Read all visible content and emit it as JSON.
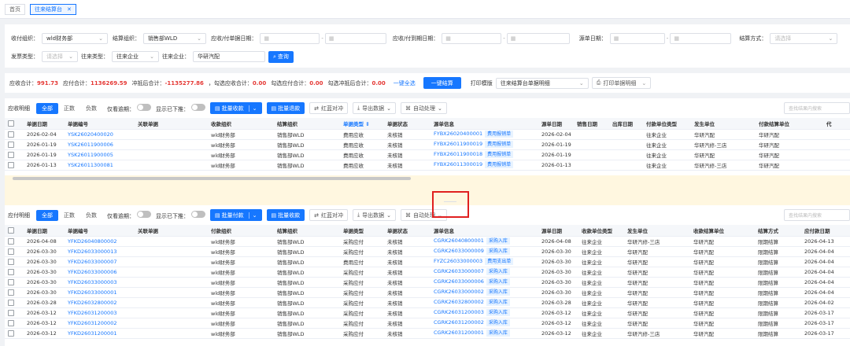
{
  "tabs": [
    {
      "label": "首页"
    },
    {
      "label": "往来结算台"
    }
  ],
  "filters": {
    "row1": {
      "pay_org_label": "收付组织：",
      "pay_org_value": "wld财务部",
      "settle_org_label": "结算组织：",
      "settle_org_value": "销售部WLD",
      "ar_date_label": "应收/付单据日期：",
      "due_date_label": "应收/付到期日期：",
      "src_date_label": "源单日期：",
      "settle_method_label": "结算方式：",
      "settle_method_placeholder": "请选择"
    },
    "row2": {
      "invoice_type_label": "发票类型：",
      "invoice_type_placeholder": "请选择",
      "party_type_label": "往来类型：",
      "party_type_value": "往来企业",
      "party_label": "往来企业：",
      "party_value": "华研汽配",
      "query_label": "查询"
    }
  },
  "summary": {
    "ar_total_label": "应收合计：",
    "ar_total": "991.73",
    "ap_total_label": "应付合计：",
    "ap_total": "1136269.59",
    "offset_label": "冲抵后合计：",
    "offset_total": "-1135277.86",
    "sel_ar_label": "，勾选应收合计：",
    "sel_ar": "0.00",
    "sel_ap_label": "勾选应付合计：",
    "sel_ap": "0.00",
    "sel_offset_label": "勾选冲抵后合计：",
    "sel_offset": "0.00",
    "select_all": "一键全选",
    "one_click_settle": "一键结算",
    "print_template_label": "打印模版",
    "print_template_value": "往来结算台单据明细",
    "print_label": "打印单据明细"
  },
  "ar": {
    "title": "应收明细",
    "seg": [
      "全部",
      "正数",
      "负数"
    ],
    "overdue": "仅看逾期：",
    "show_settled": "显示已下推：",
    "batch_receive": "批量收款",
    "batch_refund": "批量退款",
    "red_offset": "红蓝对冲",
    "export": "导出数据",
    "auto_process": "自动处理",
    "search_placeholder": "查找结果内搜索",
    "columns": [
      "单据日期",
      "单据编号",
      "关联单据",
      "收款组织",
      "结算组织",
      "单据类型",
      "单据状态",
      "源单信息",
      "源单日期",
      "销售日期",
      "出库日期",
      "付款单位类型",
      "发生单位",
      "付款结算单位",
      "代"
    ],
    "rows": [
      {
        "date": "2026-02-04",
        "no": "YSK26020400020",
        "rel": "",
        "org": "wld财务部",
        "sorg": "销售部WLD",
        "type": "费用应收",
        "status": "未核销",
        "src": "FYBX26020400001",
        "tag": "费用报销单",
        "srcdate": "2026-02-04",
        "saledate": "",
        "outdate": "",
        "ptype": "往来企业",
        "unit": "华研汽配",
        "sunit": "华研汽配"
      },
      {
        "date": "2026-01-19",
        "no": "YSK26011900006",
        "rel": "",
        "org": "wld财务部",
        "sorg": "销售部WLD",
        "type": "费用应收",
        "status": "未核销",
        "src": "FYBX26011900019",
        "tag": "费用报销单",
        "srcdate": "2026-01-19",
        "saledate": "",
        "outdate": "",
        "ptype": "往来企业",
        "unit": "华研汽修-三店",
        "sunit": "华研汽配"
      },
      {
        "date": "2026-01-19",
        "no": "YSK26011900005",
        "rel": "",
        "org": "wld财务部",
        "sorg": "销售部WLD",
        "type": "费用应收",
        "status": "未核销",
        "src": "FYBX26011900018",
        "tag": "费用报销单",
        "srcdate": "2026-01-19",
        "saledate": "",
        "outdate": "",
        "ptype": "往来企业",
        "unit": "华研汽配",
        "sunit": "华研汽配"
      },
      {
        "date": "2026-01-13",
        "no": "YSK26011300081",
        "rel": "",
        "org": "wld财务部",
        "sorg": "销售部WLD",
        "type": "费用应收",
        "status": "未核销",
        "src": "FYBX26011300019",
        "tag": "费用报销单",
        "srcdate": "2026-01-13",
        "saledate": "",
        "outdate": "",
        "ptype": "往来企业",
        "unit": "华研汽修-三店",
        "sunit": "华研汽配"
      }
    ]
  },
  "ap": {
    "title": "应付明细",
    "seg": [
      "全部",
      "正数",
      "负数"
    ],
    "overdue": "仅看逾期：",
    "show_settled": "显示已下推：",
    "batch_pay": "批量付款",
    "batch_receive": "批量收款",
    "red_offset": "红蓝对冲",
    "export": "导出数据",
    "auto_process": "自动处理",
    "search_placeholder": "查找结果内搜索",
    "columns": [
      "单据日期",
      "单据编号",
      "关联单据",
      "付款组织",
      "结算组织",
      "单据类型",
      "单据状态",
      "源单信息",
      "源单日期",
      "收款单位类型",
      "发生单位",
      "收款结算单位",
      "结算方式",
      "应付款日期"
    ],
    "rows": [
      {
        "date": "2026-04-08",
        "no": "YFKD26040800002",
        "org": "wld财务部",
        "sorg": "销售部WLD",
        "type": "采购应付",
        "status": "未核销",
        "src": "CGRK26040800001",
        "tag": "采购入库",
        "srcdate": "2026-04-08",
        "utype": "往来企业",
        "unit": "华研汽修-三店",
        "sunit": "华研汽配",
        "method": "限期结算",
        "due": "2026-04-13"
      },
      {
        "date": "2026-03-30",
        "no": "YFKD26033000013",
        "org": "wld财务部",
        "sorg": "销售部WLD",
        "type": "采购应付",
        "status": "未核销",
        "src": "CGRK26033000009",
        "tag": "采购入库",
        "srcdate": "2026-03-30",
        "utype": "往来企业",
        "unit": "华研汽配",
        "sunit": "华研汽配",
        "method": "限期结算",
        "due": "2026-04-04"
      },
      {
        "date": "2026-03-30",
        "no": "YFKD26033000007",
        "org": "wld财务部",
        "sorg": "销售部WLD",
        "type": "费用应付",
        "status": "未核销",
        "src": "FYZC26033000003",
        "tag": "费用支出单",
        "srcdate": "2026-03-30",
        "utype": "往来企业",
        "unit": "华研汽配",
        "sunit": "华研汽配",
        "method": "限期结算",
        "due": "2026-04-04"
      },
      {
        "date": "2026-03-30",
        "no": "YFKD26033000006",
        "org": "wld财务部",
        "sorg": "销售部WLD",
        "type": "采购应付",
        "status": "未核销",
        "src": "CGRK26033000007",
        "tag": "采购入库",
        "srcdate": "2026-03-30",
        "utype": "往来企业",
        "unit": "华研汽配",
        "sunit": "华研汽配",
        "method": "限期结算",
        "due": "2026-04-04"
      },
      {
        "date": "2026-03-30",
        "no": "YFKD26033000003",
        "org": "wld财务部",
        "sorg": "销售部WLD",
        "type": "采购应付",
        "status": "未核销",
        "src": "CGRK26033000006",
        "tag": "采购入库",
        "srcdate": "2026-03-30",
        "utype": "往来企业",
        "unit": "华研汽配",
        "sunit": "华研汽配",
        "method": "限期结算",
        "due": "2026-04-04"
      },
      {
        "date": "2026-03-30",
        "no": "YFKD26033000001",
        "org": "wld财务部",
        "sorg": "销售部WLD",
        "type": "采购应付",
        "status": "未核销",
        "src": "CGRK26033000002",
        "tag": "采购入库",
        "srcdate": "2026-03-30",
        "utype": "往来企业",
        "unit": "华研汽配",
        "sunit": "华研汽配",
        "method": "限期结算",
        "due": "2026-04-04"
      },
      {
        "date": "2026-03-28",
        "no": "YFKD26032800002",
        "org": "wld财务部",
        "sorg": "销售部WLD",
        "type": "采购应付",
        "status": "未核销",
        "src": "CGRK26032800002",
        "tag": "采购入库",
        "srcdate": "2026-03-28",
        "utype": "往来企业",
        "unit": "华研汽配",
        "sunit": "华研汽配",
        "method": "限期结算",
        "due": "2026-04-02"
      },
      {
        "date": "2026-03-12",
        "no": "YFKD26031200003",
        "org": "wld财务部",
        "sorg": "销售部WLD",
        "type": "采购应付",
        "status": "未核销",
        "src": "CGRK26031200003",
        "tag": "采购入库",
        "srcdate": "2026-03-12",
        "utype": "往来企业",
        "unit": "华研汽配",
        "sunit": "华研汽配",
        "method": "限期结算",
        "due": "2026-03-17"
      },
      {
        "date": "2026-03-12",
        "no": "YFKD26031200002",
        "org": "wld财务部",
        "sorg": "销售部WLD",
        "type": "采购应付",
        "status": "未核销",
        "src": "CGRK26031200002",
        "tag": "采购入库",
        "srcdate": "2026-03-12",
        "utype": "往来企业",
        "unit": "华研汽配",
        "sunit": "华研汽配",
        "method": "限期结算",
        "due": "2026-03-17"
      },
      {
        "date": "2026-03-12",
        "no": "YFKD26031200001",
        "org": "wld财务部",
        "sorg": "销售部WLD",
        "type": "采购应付",
        "status": "未核销",
        "src": "CGRK26031200001",
        "tag": "采购入库",
        "srcdate": "2026-03-12",
        "utype": "往来企业",
        "unit": "华研汽修-三店",
        "sunit": "华研汽配",
        "method": "限期结算",
        "due": "2026-03-17"
      }
    ]
  },
  "colors": {
    "primary": "#1677ff",
    "danger": "#e53935",
    "highlight": "#e02020",
    "panel": "#fff7e0"
  }
}
